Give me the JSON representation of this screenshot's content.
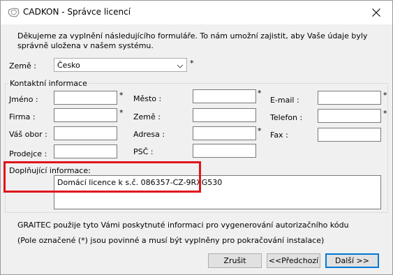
{
  "window": {
    "title": "CADKON - Správce licencí",
    "close_glyph": "close-icon",
    "app_icon": "cadkon-logo-icon"
  },
  "intro_text": "Děkujeme za vyplnění následujícího formuláře. To nám umožní zajistit, aby Vaše údaje byly správně uložena v našem systému.",
  "country": {
    "label": "Země :",
    "value": "Česko",
    "required_mark": "*"
  },
  "contact_group": {
    "label": "Kontaktní informace",
    "name_label": "Jméno :",
    "company_label": "Firma :",
    "field_label": "Váš obor :",
    "dealer_label": "Prodejce :",
    "city_label": "Město :",
    "country_label": "Země :",
    "address_label": "Adresa :",
    "zip_label": "PSČ :",
    "email_label": "E-mail :",
    "phone_label": "Telefon :",
    "fax_label": "Fax :",
    "required_mark": "*",
    "name_value": "",
    "company_value": "",
    "field_value": "",
    "dealer_value": "",
    "city_value": "",
    "country_value": "",
    "address_value": "",
    "zip_value": "",
    "email_value": "",
    "phone_value": "",
    "fax_value": ""
  },
  "additional": {
    "label": "Doplňující informace:",
    "value": "Domácí licence k s.č. 086357-CZ-9RXG530"
  },
  "footer_note_1": "GRAITEC použije tyto Vámi poskytnuté informaci pro vygenerování autorizačního kódu",
  "footer_note_2": "(Pole označené (*) jsou povinné a musí být vyplněny pro pokračování instalace)",
  "buttons": {
    "cancel": "Zrušit",
    "back": "<<Předchozí",
    "next": "Další >>"
  },
  "colors": {
    "highlight": "#e0141b",
    "default_button_border": "#0078d7"
  }
}
